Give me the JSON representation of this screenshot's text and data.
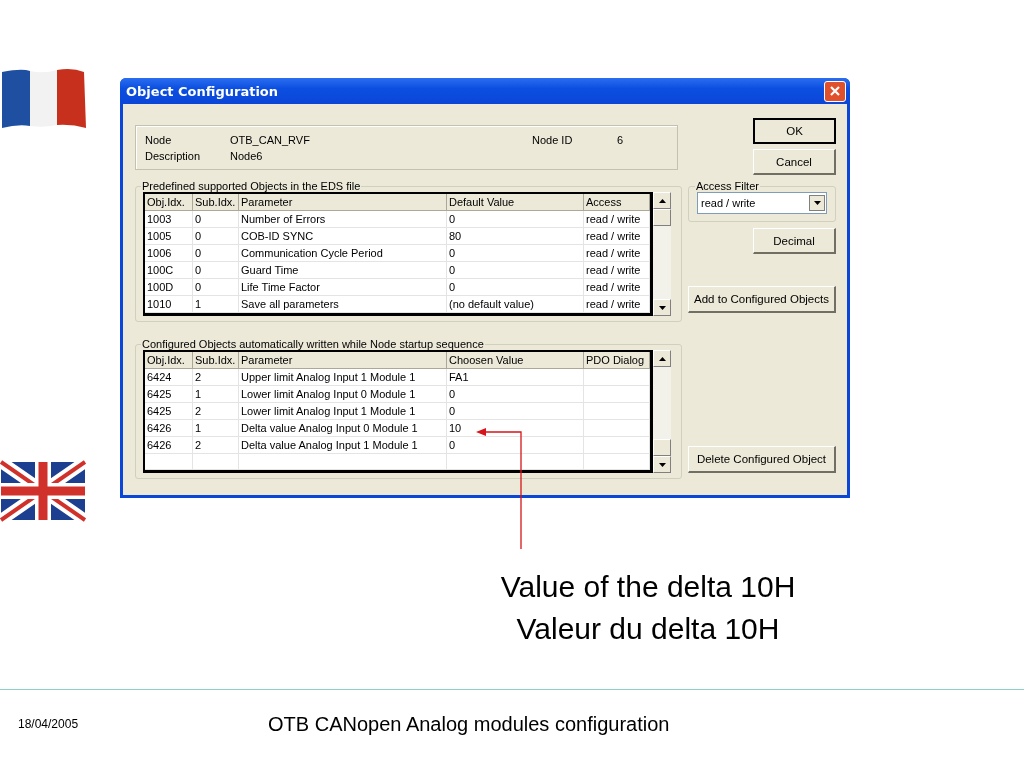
{
  "window": {
    "title": "Object Configuration"
  },
  "node_info": {
    "node_label": "Node",
    "node_value": "OTB_CAN_RVF",
    "description_label": "Description",
    "description_value": "Node6",
    "node_id_label": "Node ID",
    "node_id_value": "6"
  },
  "predefined": {
    "title": "Predefined supported Objects in the EDS file",
    "columns": [
      "Obj.Idx.",
      "Sub.Idx.",
      "Parameter",
      "Default Value",
      "Access"
    ],
    "rows": [
      [
        "1003",
        "0",
        "Number of Errors",
        "0",
        "read / write"
      ],
      [
        "1005",
        "0",
        "COB-ID SYNC",
        "80",
        "read / write"
      ],
      [
        "1006",
        "0",
        "Communication Cycle Period",
        "0",
        "read / write"
      ],
      [
        "100C",
        "0",
        "Guard Time",
        "0",
        "read / write"
      ],
      [
        "100D",
        "0",
        "Life Time Factor",
        "0",
        "read / write"
      ],
      [
        "1010",
        "1",
        "Save all parameters",
        "(no default value)",
        "read / write"
      ]
    ]
  },
  "configured": {
    "title": "Configured Objects automatically written while Node startup sequence",
    "columns": [
      "Obj.Idx.",
      "Sub.Idx.",
      "Parameter",
      "Choosen Value",
      "PDO Dialog"
    ],
    "rows": [
      [
        "6424",
        "2",
        "Upper limit Analog Input 1 Module 1",
        "FA1"
      ],
      [
        "6425",
        "1",
        "Lower limit Analog Input 0 Module 1",
        "0"
      ],
      [
        "6425",
        "2",
        "Lower limit Analog Input 1 Module 1",
        "0"
      ],
      [
        "6426",
        "1",
        "Delta value Analog Input 0 Module 1",
        "10"
      ],
      [
        "6426",
        "2",
        "Delta value Analog Input 1 Module 1",
        "0"
      ]
    ]
  },
  "ok_button": {
    "label": "OK",
    "default": true
  },
  "cancel_button": {
    "label": "Cancel",
    "default": false
  },
  "access_filter": {
    "label": "Access Filter",
    "value": "read / write"
  },
  "decimal_button": "Decimal",
  "add_button": "Add to Configured Objects",
  "delete_button": "Delete Configured Object",
  "callout": [
    "Value of the delta 10H",
    "Valeur du delta 10H"
  ],
  "footer": {
    "date": "18/04/2005",
    "title": "OTB CANopen Analog modules configuration"
  }
}
